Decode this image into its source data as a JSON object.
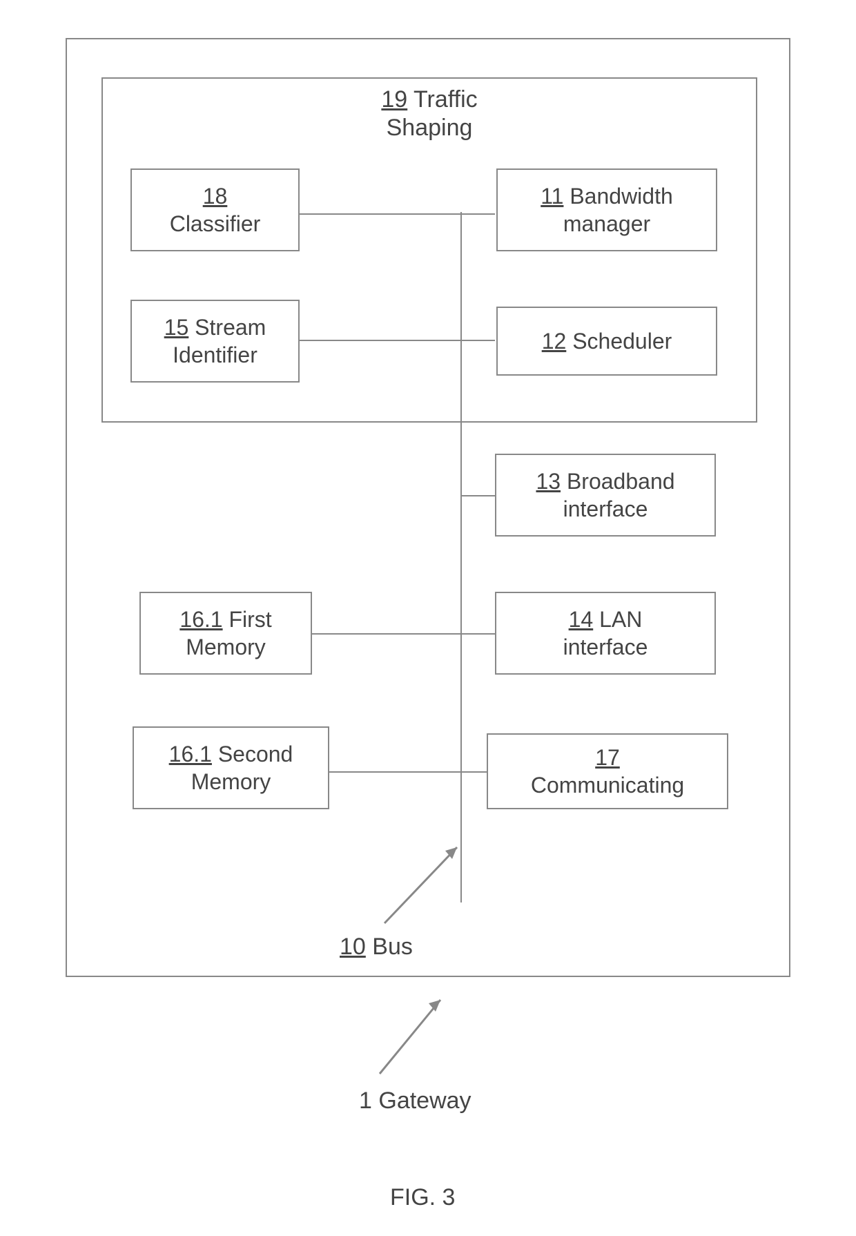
{
  "figure_label": "FIG. 3",
  "gateway": {
    "num": "1",
    "label": "Gateway"
  },
  "bus": {
    "num": "10",
    "label": "Bus"
  },
  "traffic_shaping": {
    "num": "19",
    "label_line1": "Traffic",
    "label_line2": "Shaping"
  },
  "modules": {
    "classifier": {
      "num": "18",
      "label": "Classifier"
    },
    "bandwidth_manager": {
      "num": "11",
      "label_line1": "Bandwidth",
      "label_line2": "manager"
    },
    "stream_identifier": {
      "num": "15",
      "label_line1": "Stream",
      "label_line2": "Identifier"
    },
    "scheduler": {
      "num": "12",
      "label": "Scheduler"
    },
    "broadband_interface": {
      "num": "13",
      "label_line1": "Broadband",
      "label_line2": "interface"
    },
    "first_memory": {
      "num": "16.1",
      "label_line1": "First",
      "label_line2": "Memory"
    },
    "lan_interface": {
      "num": "14",
      "label_line1": "LAN",
      "label_line2": "interface"
    },
    "second_memory": {
      "num": "16.1",
      "label_line1": "Second",
      "label_line2": "Memory"
    },
    "communicating": {
      "num": "17",
      "label": "Communicating"
    }
  }
}
